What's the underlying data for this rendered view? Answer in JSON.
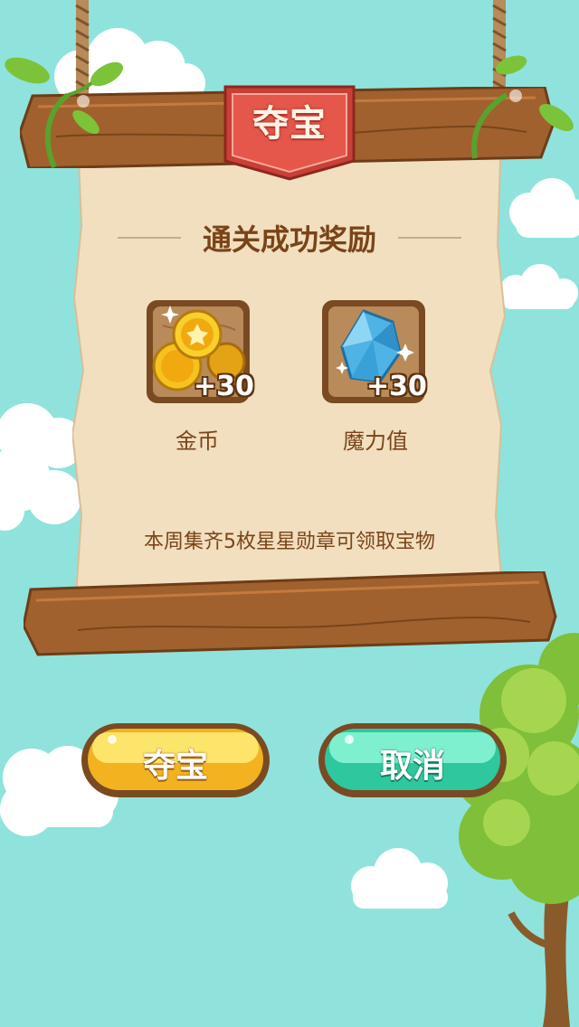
{
  "banner": {
    "title": "夺宝"
  },
  "reward": {
    "title": "通关成功奖励",
    "items": [
      {
        "icon": "gold-coins-icon",
        "amount": "+30",
        "label": "金币"
      },
      {
        "icon": "blue-gem-icon",
        "amount": "+30",
        "label": "魔力值"
      }
    ]
  },
  "note": "本周集齐5枚星星勋章可领取宝物",
  "buttons": {
    "treasure": "夺宝",
    "cancel": "取消"
  },
  "colors": {
    "sky": "#8fe3dc",
    "wood": "#9c5a2a",
    "parchment": "#f1dfc0",
    "gold_button": "#f7c12b",
    "green_button": "#3ed9ad",
    "banner_red": "#e5574a"
  }
}
